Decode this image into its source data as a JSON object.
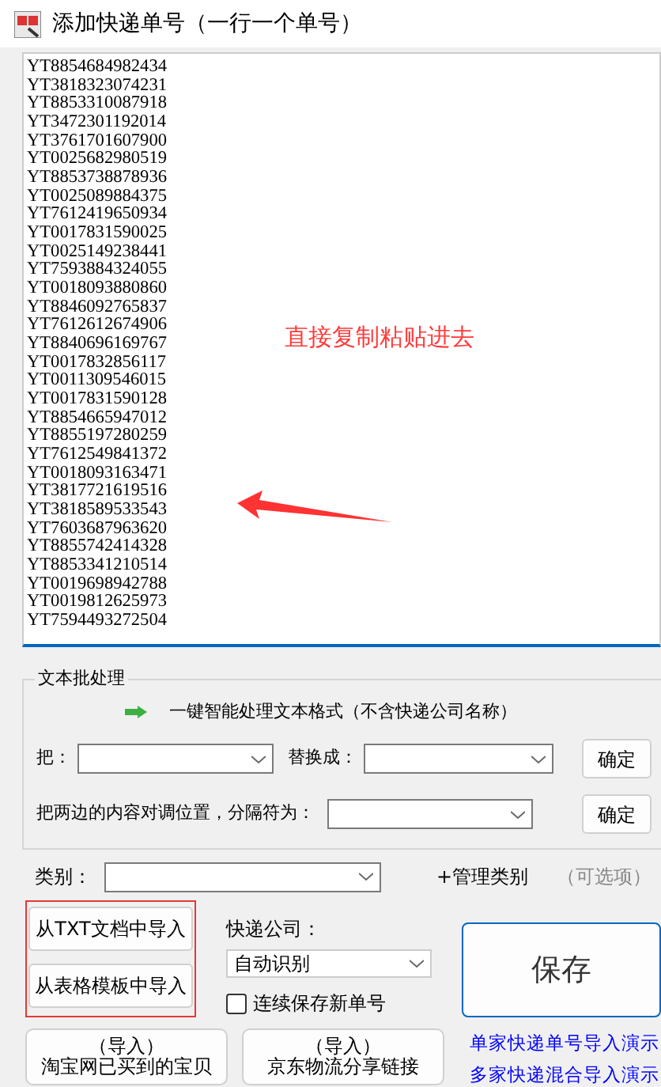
{
  "window": {
    "title": "添加快递单号（一行一个单号）"
  },
  "tracking_numbers": [
    "YT8854684982434",
    "YT3818323074231",
    "YT8853310087918",
    "YT3472301192014",
    "YT3761701607900",
    "YT0025682980519",
    "YT8853738878936",
    "YT0025089884375",
    "YT7612419650934",
    "YT0017831590025",
    "YT0025149238441",
    "YT7593884324055",
    "YT0018093880860",
    "YT8846092765837",
    "YT7612612674906",
    "YT8840696169767",
    "YT0017832856117",
    "YT0011309546015",
    "YT0017831590128",
    "YT8854665947012",
    "YT8855197280259",
    "YT7612549841372",
    "YT0018093163471",
    "YT3817721619516",
    "YT3818589533543",
    "YT7603687963620",
    "YT8855742414328",
    "YT8853341210514",
    "YT0019698942788",
    "YT0019812625973",
    "YT7594493272504"
  ],
  "annotation": {
    "text": "直接复制粘贴进去"
  },
  "batch": {
    "title": "文本批处理",
    "smart_format": "一键智能处理文本格式（不含快递公司名称）",
    "replace_label": "把：",
    "replace_with_label": "替换成：",
    "confirm_replace": "确定",
    "swap_label": "把两边的内容对调位置，分隔符为：",
    "confirm_swap": "确定"
  },
  "category": {
    "label": "类别：",
    "manage": "+管理类别",
    "optional": "（可选项）"
  },
  "import_buttons": [
    "从TXT文档中导入",
    "从表格模板中导入"
  ],
  "courier": {
    "label": "快递公司：",
    "value": "自动识别",
    "continuous_save": {
      "label": "连续保存新单号",
      "checked": false
    }
  },
  "save": "保存",
  "bottom_buttons": [
    {
      "line_1": "（导入）",
      "line_2": "淘宝网已买到的宝贝"
    },
    {
      "line_1": "（导入）",
      "line_2": "京东物流分享链接"
    }
  ],
  "demo_links": [
    "单家快递单号导入演示",
    "多家快递混合导入演示"
  ]
}
